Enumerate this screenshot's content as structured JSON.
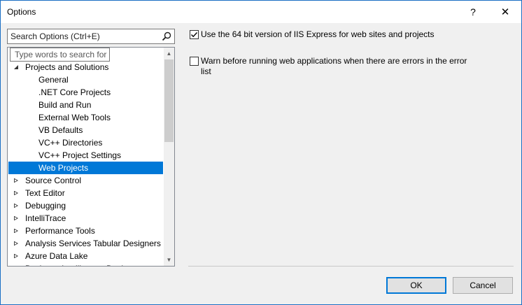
{
  "window": {
    "title": "Options",
    "help_glyph": "?",
    "close_glyph": "✕"
  },
  "search": {
    "placeholder": "Search Options (Ctrl+E)",
    "icon": "search-icon",
    "tooltip": "Type words to search for"
  },
  "tree": {
    "items": [
      {
        "label": "Projects and Solutions",
        "level": 0,
        "expanded": true
      },
      {
        "label": "General",
        "level": 1
      },
      {
        "label": ".NET Core Projects",
        "level": 1
      },
      {
        "label": "Build and Run",
        "level": 1
      },
      {
        "label": "External Web Tools",
        "level": 1
      },
      {
        "label": "VB Defaults",
        "level": 1
      },
      {
        "label": "VC++ Directories",
        "level": 1
      },
      {
        "label": "VC++ Project Settings",
        "level": 1
      },
      {
        "label": "Web Projects",
        "level": 1,
        "selected": true
      },
      {
        "label": "Source Control",
        "level": 0,
        "expanded": false
      },
      {
        "label": "Text Editor",
        "level": 0,
        "expanded": false
      },
      {
        "label": "Debugging",
        "level": 0,
        "expanded": false
      },
      {
        "label": "IntelliTrace",
        "level": 0,
        "expanded": false
      },
      {
        "label": "Performance Tools",
        "level": 0,
        "expanded": false
      },
      {
        "label": "Analysis Services Tabular Designers",
        "level": 0,
        "expanded": false
      },
      {
        "label": "Azure Data Lake",
        "level": 0,
        "expanded": false
      },
      {
        "label": "Business Intelligence Designers",
        "level": 0,
        "expanded": false
      }
    ]
  },
  "options": {
    "use_64bit": {
      "label": "Use the 64 bit version of IIS Express for web sites and projects",
      "checked": true
    },
    "warn_errors": {
      "label": "Warn before running web applications when there are errors in the error list",
      "checked": false
    }
  },
  "buttons": {
    "ok": "OK",
    "cancel": "Cancel"
  },
  "colors": {
    "selection": "#0078d7",
    "window_border": "#1a6fc4"
  }
}
